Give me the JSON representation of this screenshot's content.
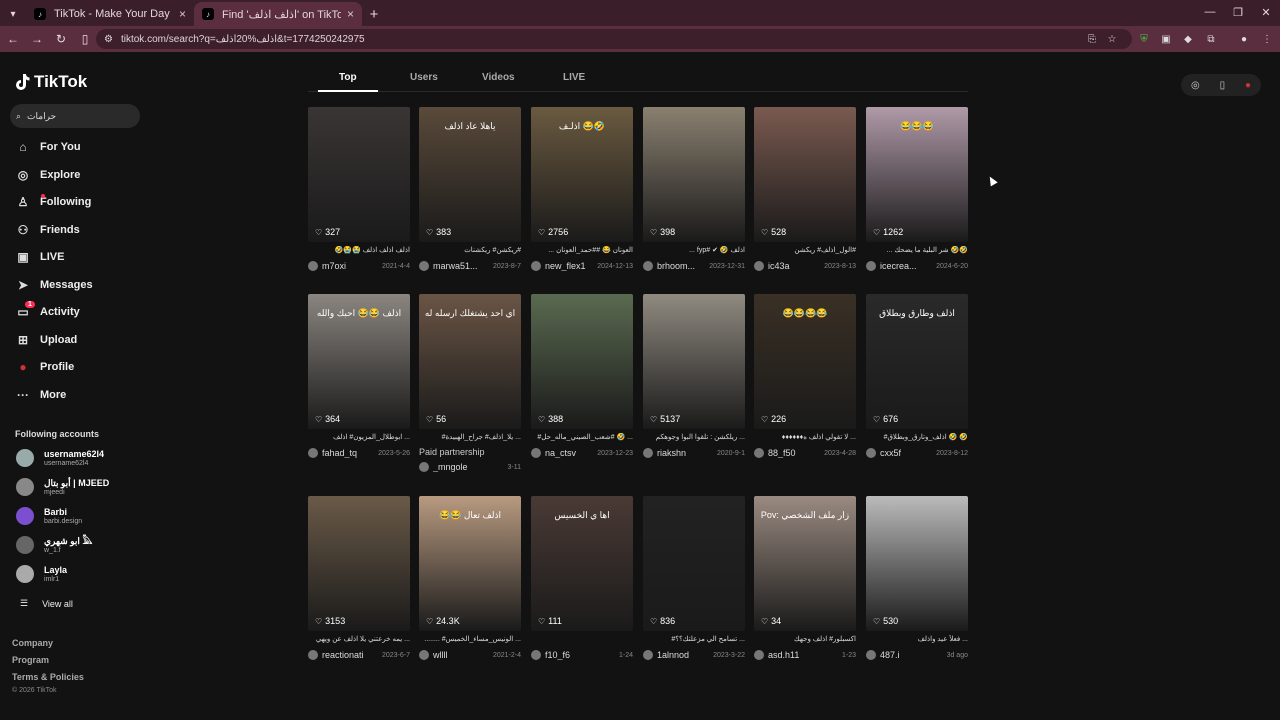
{
  "browser": {
    "tabs": [
      {
        "title": "TikTok - Make Your Day"
      },
      {
        "title": "Find 'اذلف اذلف' on TikTok | Ti"
      }
    ],
    "url": "tiktok.com/search?q=اذلف%20اذلف&t=1774250242975"
  },
  "sidebar": {
    "logo": "TikTok",
    "search_value": "حرامات",
    "nav": [
      {
        "label": "For You",
        "icon": "home-icon"
      },
      {
        "label": "Explore",
        "icon": "compass-icon"
      },
      {
        "label": "Following",
        "icon": "user-icon"
      },
      {
        "label": "Friends",
        "icon": "friends-icon"
      },
      {
        "label": "LIVE",
        "icon": "live-icon"
      },
      {
        "label": "Messages",
        "icon": "messages-icon"
      },
      {
        "label": "Activity",
        "icon": "activity-icon",
        "badge": "1"
      },
      {
        "label": "Upload",
        "icon": "upload-icon"
      },
      {
        "label": "Profile",
        "icon": "avatar"
      },
      {
        "label": "More",
        "icon": "more-icon"
      }
    ],
    "following_title": "Following accounts",
    "accounts": [
      {
        "name": "username62l4",
        "handle": "username62l4",
        "color": "#9aa"
      },
      {
        "name": "أبو بتال | MJEED",
        "handle": "mjeedi",
        "color": "#888"
      },
      {
        "name": "Barbi",
        "handle": "barbi.design",
        "color": "#7b4fd0"
      },
      {
        "name": "ابو شهري 𓅓",
        "handle": "w_1.f",
        "color": "#666"
      },
      {
        "name": "Layla",
        "handle": "imlr1",
        "color": "#aaa"
      }
    ],
    "view_all": "View all",
    "footer": [
      "Company",
      "Program",
      "Terms & Policies"
    ],
    "copyright": "© 2026 TikTok"
  },
  "search_tabs": [
    "Top",
    "Users",
    "Videos",
    "LIVE"
  ],
  "videos": [
    {
      "likes": "327",
      "caption": "اذلف اذلف اذلف 😭😭🤣",
      "user": "m7oxi",
      "date": "2021-4-4",
      "bg": "#3a3535"
    },
    {
      "likes": "383",
      "caption": "#ريكشن# ريكشنات",
      "user": "marwa51...",
      "date": "2023-8-7",
      "bg": "#5a4a3a",
      "overlay": "ياهلا عاد اذلف"
    },
    {
      "likes": "2756",
      "caption": "العونان 😂 ##حمد_العونان ...",
      "user": "new_flex1",
      "date": "2024-12-13",
      "bg": "#6a5a40",
      "overlay": "اذلـف 😂🤣"
    },
    {
      "likes": "398",
      "caption": "اذلف 🤣 ✔ #fyp ...",
      "user": "brhoom...",
      "date": "2023-12-31",
      "bg": "#8a8070"
    },
    {
      "likes": "528",
      "caption": "#الول_اذلف# ريكشن",
      "user": "ic43a",
      "date": "2023-8-13",
      "bg": "#7a5a50"
    },
    {
      "likes": "1262",
      "caption": "🤣🤣 شر البلية ما يضحك ...",
      "user": "icecrea...",
      "date": "2024-6-20",
      "bg": "#b09aa8",
      "overlay": "😂😂😂"
    },
    {
      "likes": "364",
      "caption": "... ابوطلال_المزيون# اذلف",
      "user": "fahad_tq",
      "date": "2023-5-26",
      "bg": "#8a8580",
      "overlay": "اذلف 😂😂 احبك والله"
    },
    {
      "likes": "56",
      "caption": "... يلا_اذلف# جراح_الهبيدة#",
      "user": "_mngole",
      "date": "3-11",
      "bg": "#6a5545",
      "overlay": "اي احد يشتغلك ارسله له",
      "partnership": "Paid partnership"
    },
    {
      "likes": "388",
      "caption": "... 🤣 #شعب_الصيني_ماله_حل#",
      "user": "na_ctsv",
      "date": "2023-12-23",
      "bg": "#5a6a50"
    },
    {
      "likes": "5137",
      "caption": "... ريلكشن : تلقوا البوا وجوهكم",
      "user": "riakshn",
      "date": "2020-9-1",
      "bg": "#908a80"
    },
    {
      "likes": "226",
      "caption": "... لا تقولي اذلف ه♦♦♦♦♦♦",
      "user": "88_f50",
      "date": "2023-4-28",
      "bg": "#3a3025",
      "overlay": "😂😂😂😂"
    },
    {
      "likes": "676",
      "caption": "🤣 🤣 اذلف_وتارق_وبطلاق#",
      "user": "cxx5f",
      "date": "2023-8-12",
      "bg": "#2a2a2a",
      "overlay": "اذلف وطارق وبطلاق"
    },
    {
      "likes": "3153",
      "caption": "... يمه خرعتني يلا اذلف عن ويهي",
      "user": "reactionati",
      "date": "2023-6-7",
      "bg": "#6a5a48"
    },
    {
      "likes": "24.3K",
      "caption": "... الونيس_مساء_الخميس# ........",
      "user": "wllll",
      "date": "2021-2-4",
      "bg": "#b89a80",
      "overlay": "😂😂 اذلف تعال"
    },
    {
      "likes": "111",
      "caption": "",
      "user": "f10_f6",
      "date": "1-24",
      "bg": "#4a3a35",
      "overlay": "اها ي الخسيس"
    },
    {
      "likes": "836",
      "caption": "... تسامح الي مزعلتك؟؟#",
      "user": "1alnnod",
      "date": "2023-3-22",
      "bg": "#222222"
    },
    {
      "likes": "34",
      "caption": "اكسبلور# اذلف وجهك",
      "user": "asd.h11",
      "date": "1-23",
      "bg": "#9a8a80",
      "overlay": "Pov: زار ملف الشخصي"
    },
    {
      "likes": "530",
      "caption": "... فعلاً عيد واذلف",
      "user": "487.i",
      "date": "3d ago",
      "bg": "#bbbbbb"
    }
  ],
  "colors": {
    "accent": "#fe2c55",
    "bg": "#121212",
    "chrome": "#5a2e3f"
  }
}
